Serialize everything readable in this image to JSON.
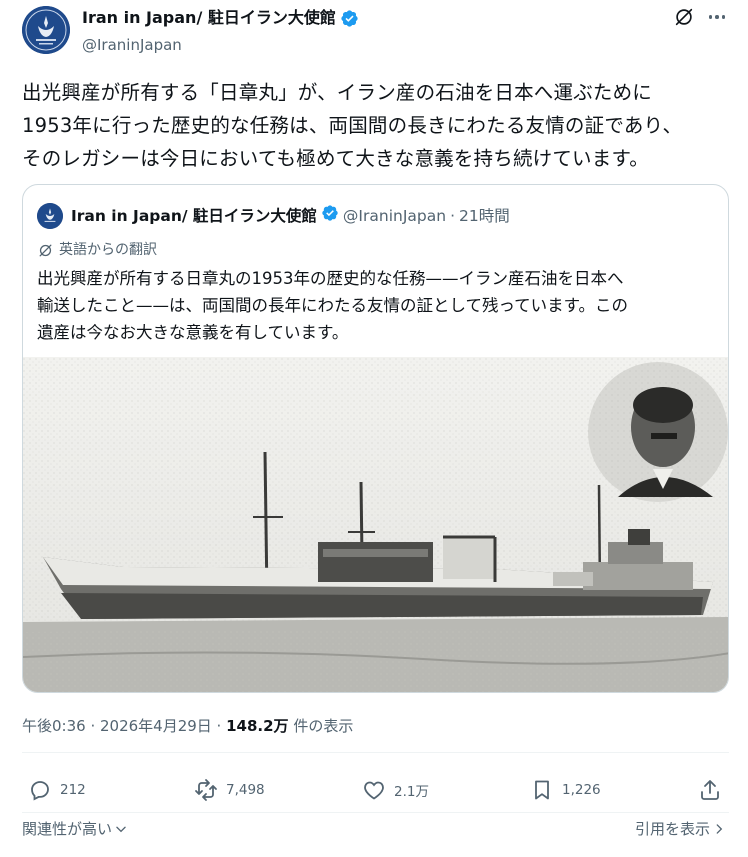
{
  "post": {
    "author": {
      "display_name": "Iran in Japan/ 駐日イラン大使館",
      "handle": "@IraninJapan",
      "verified": true
    },
    "text_lines": [
      "出光興産が所有する「日章丸」が、イラン産の石油を日本へ運ぶために",
      "1953年に行った歴史的な任務は、両国間の長きにわたる友情の証であり、",
      "そのレガシーは今日においても極めて大きな意義を持ち続けています。"
    ],
    "timestamp": "午後0:36 · 2026年4月29日 · ",
    "views_count": "148.2万",
    "views_label": " 件の表示",
    "stats": {
      "replies": "212",
      "reposts": "7,498",
      "likes": "2.1万",
      "bookmarks": "1,226"
    },
    "footer": {
      "sort_label": "関連性が高い",
      "quotes_label": "引用を表示"
    }
  },
  "quoted": {
    "display_name": "Iran in Japan/ 駐日イラン大使館",
    "handle": "@IraninJapan",
    "separator": "·",
    "time": "21時間",
    "translation_note": "英語からの翻訳",
    "text_lines": [
      "出光興産が所有する日章丸の1953年の歴史的な任務——イラン産石油を日本へ",
      "輸送したこと——は、両国間の長年にわたる友情の証として残っています。この",
      "遺産は今なお大きな意義を有しています。"
    ],
    "image": "black-and-white photo of tanker ship with portrait inset"
  },
  "colors": {
    "text": "#0f1419",
    "muted": "#536471",
    "verified": "#1d9bf0",
    "border": "#cfd9de"
  },
  "icons": [
    "grok-icon",
    "more-icon",
    "reply-icon",
    "repost-icon",
    "like-icon",
    "bookmark-icon",
    "share-icon",
    "chevron-down-icon",
    "chevron-right-icon",
    "translate-icon",
    "verified-icon"
  ]
}
